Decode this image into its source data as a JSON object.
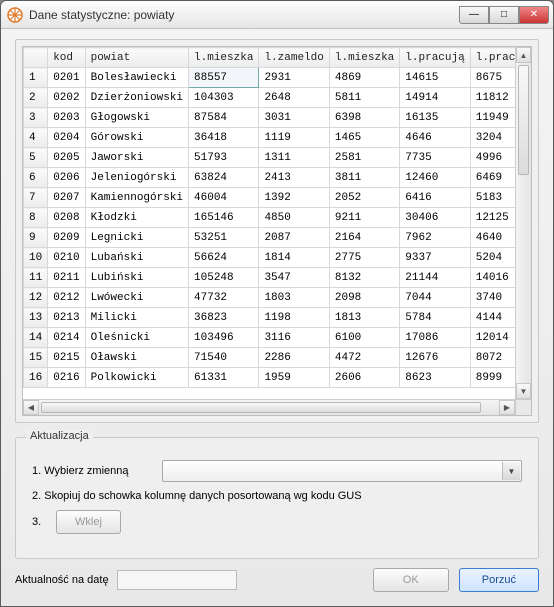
{
  "window": {
    "title": "Dane statystyczne: powiaty"
  },
  "table": {
    "headers": [
      "",
      "kod",
      "powiat",
      "l.mieszka",
      "l.zameldo",
      "l.mieszka",
      "l.pracują",
      "l.pracu"
    ],
    "rows": [
      {
        "n": "1",
        "kod": "0201",
        "powiat": "Bolesławiecki",
        "c1": "88557",
        "c2": "2931",
        "c3": "4869",
        "c4": "14615",
        "c5": "8675"
      },
      {
        "n": "2",
        "kod": "0202",
        "powiat": "Dzierżoniowski",
        "c1": "104303",
        "c2": "2648",
        "c3": "5811",
        "c4": "14914",
        "c5": "11812"
      },
      {
        "n": "3",
        "kod": "0203",
        "powiat": "Głogowski",
        "c1": "87584",
        "c2": "3031",
        "c3": "6398",
        "c4": "16135",
        "c5": "11949"
      },
      {
        "n": "4",
        "kod": "0204",
        "powiat": "Górowski",
        "c1": "36418",
        "c2": "1119",
        "c3": "1465",
        "c4": "4646",
        "c5": "3204"
      },
      {
        "n": "5",
        "kod": "0205",
        "powiat": "Jaworski",
        "c1": "51793",
        "c2": "1311",
        "c3": "2581",
        "c4": "7735",
        "c5": "4996"
      },
      {
        "n": "6",
        "kod": "0206",
        "powiat": "Jeleniogórski",
        "c1": "63824",
        "c2": "2413",
        "c3": "3811",
        "c4": "12460",
        "c5": "6469"
      },
      {
        "n": "7",
        "kod": "0207",
        "powiat": "Kamiennogórski",
        "c1": "46004",
        "c2": "1392",
        "c3": "2052",
        "c4": "6416",
        "c5": "5183"
      },
      {
        "n": "8",
        "kod": "0208",
        "powiat": "Kłodzki",
        "c1": "165146",
        "c2": "4850",
        "c3": "9211",
        "c4": "30406",
        "c5": "12125"
      },
      {
        "n": "9",
        "kod": "0209",
        "powiat": "Legnicki",
        "c1": "53251",
        "c2": "2087",
        "c3": "2164",
        "c4": "7962",
        "c5": "4640"
      },
      {
        "n": "10",
        "kod": "0210",
        "powiat": "Lubański",
        "c1": "56624",
        "c2": "1814",
        "c3": "2775",
        "c4": "9337",
        "c5": "5204"
      },
      {
        "n": "11",
        "kod": "0211",
        "powiat": "Lubiński",
        "c1": "105248",
        "c2": "3547",
        "c3": "8132",
        "c4": "21144",
        "c5": "14016"
      },
      {
        "n": "12",
        "kod": "0212",
        "powiat": "Lwówecki",
        "c1": "47732",
        "c2": "1803",
        "c3": "2098",
        "c4": "7044",
        "c5": "3740"
      },
      {
        "n": "13",
        "kod": "0213",
        "powiat": "Milicki",
        "c1": "36823",
        "c2": "1198",
        "c3": "1813",
        "c4": "5784",
        "c5": "4144"
      },
      {
        "n": "14",
        "kod": "0214",
        "powiat": "Oleśnicki",
        "c1": "103496",
        "c2": "3116",
        "c3": "6100",
        "c4": "17086",
        "c5": "12014"
      },
      {
        "n": "15",
        "kod": "0215",
        "powiat": "Oławski",
        "c1": "71540",
        "c2": "2286",
        "c3": "4472",
        "c4": "12676",
        "c5": "8072"
      },
      {
        "n": "16",
        "kod": "0216",
        "powiat": "Polkowicki",
        "c1": "61331",
        "c2": "1959",
        "c3": "2606",
        "c4": "8623",
        "c5": "8999"
      }
    ]
  },
  "group": {
    "legend": "Aktualizacja",
    "step1": "1.  Wybierz zmienną",
    "step2": "2.  Skopiuj do schowka kolumnę danych posortowaną wg kodu GUS",
    "step3": "3.",
    "paste_label": "Wklej"
  },
  "bottom": {
    "date_label": "Aktualność na datę",
    "date_value": "",
    "ok": "OK",
    "cancel": "Porzuć"
  }
}
